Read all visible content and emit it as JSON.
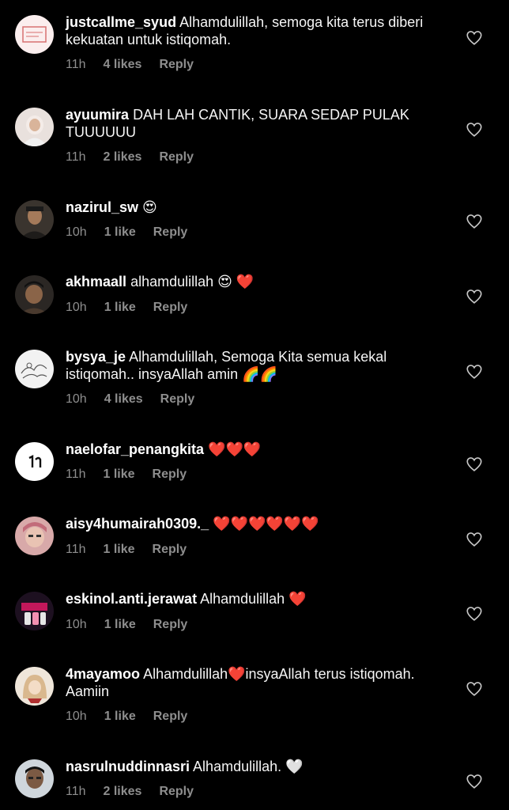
{
  "comments": [
    {
      "username": "justcallme_syud",
      "text": "Alhamdulillah, semoga kita terus diberi kekuatan untuk istiqomah.",
      "time": "11h",
      "likes": "4 likes",
      "reply": "Reply"
    },
    {
      "username": "ayuumira",
      "text": "DAH LAH CANTIK, SUARA SEDAP PULAK TUUUUUU",
      "time": "11h",
      "likes": "2 likes",
      "reply": "Reply"
    },
    {
      "username": "nazirul_sw",
      "text": "😍",
      "time": "10h",
      "likes": "1 like",
      "reply": "Reply"
    },
    {
      "username": "akhmaall",
      "text": "alhamdulillah 😍 ❤️",
      "time": "10h",
      "likes": "1 like",
      "reply": "Reply"
    },
    {
      "username": "bysya_je",
      "text": "Alhamdulillah, Semoga Kita semua kekal istiqomah.. insyaAllah amin 🌈🌈",
      "time": "10h",
      "likes": "4 likes",
      "reply": "Reply"
    },
    {
      "username": "naelofar_penangkita",
      "text": "❤️❤️❤️",
      "time": "11h",
      "likes": "1 like",
      "reply": "Reply"
    },
    {
      "username": "aisy4humairah0309._",
      "text": "❤️❤️❤️❤️❤️❤️",
      "time": "11h",
      "likes": "1 like",
      "reply": "Reply"
    },
    {
      "username": "eskinol.anti.jerawat",
      "text": "Alhamdulillah ❤️",
      "time": "10h",
      "likes": "1 like",
      "reply": "Reply"
    },
    {
      "username": "4mayamoo",
      "text": "Alhamdulillah❤️insyaAllah terus istiqomah. Aamiin",
      "time": "10h",
      "likes": "1 like",
      "reply": "Reply"
    },
    {
      "username": "nasrulnuddinnasri",
      "text": "Alhamdulillah. 🤍",
      "time": "11h",
      "likes": "2 likes",
      "reply": "Reply"
    }
  ],
  "icons": {
    "like": "heart-outline-icon"
  },
  "colors": {
    "background": "#000000",
    "meta_text": "#8e8e8e",
    "heart_emoji": "#ff2d3c"
  }
}
